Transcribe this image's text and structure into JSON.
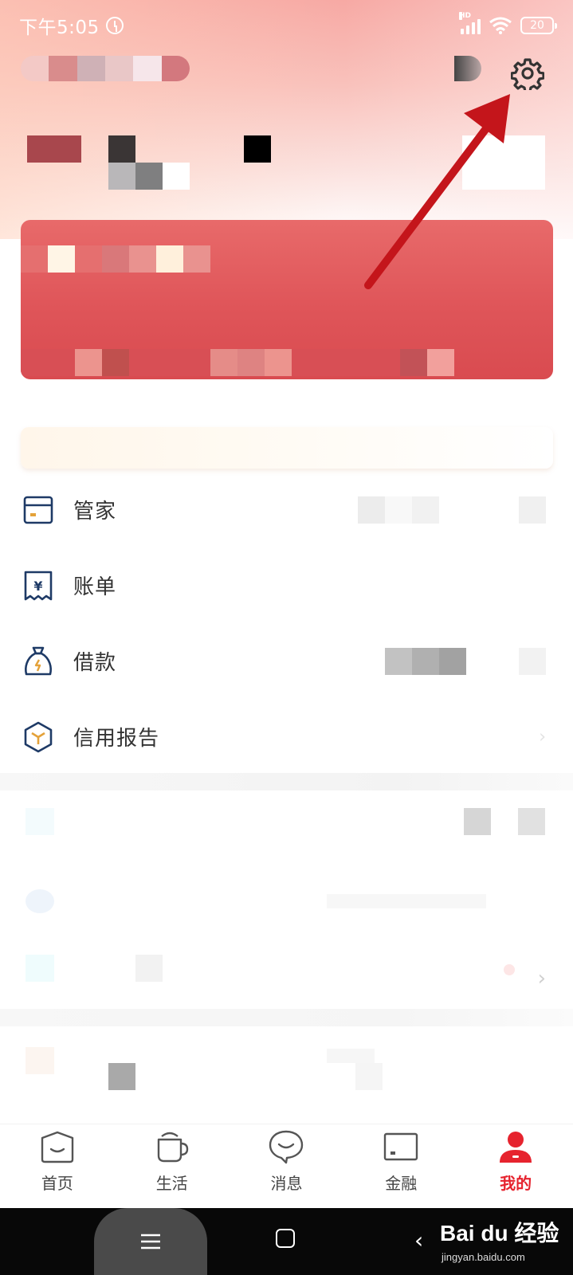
{
  "status_bar": {
    "time": "下午5:05",
    "hd_label": "HD",
    "battery": "20"
  },
  "menu": [
    {
      "label": "管家",
      "icon": "card-icon"
    },
    {
      "label": "账单",
      "icon": "yuan-receipt-icon"
    },
    {
      "label": "借款",
      "icon": "money-bag-icon"
    },
    {
      "label": "信用报告",
      "icon": "cube-icon"
    }
  ],
  "bottom_nav": [
    {
      "label": "首页",
      "icon": "home-icon"
    },
    {
      "label": "生活",
      "icon": "cup-icon"
    },
    {
      "label": "消息",
      "icon": "chat-icon"
    },
    {
      "label": "金融",
      "icon": "finance-card-icon"
    },
    {
      "label": "我的",
      "icon": "user-icon"
    }
  ],
  "active_tab": "我的",
  "colors": {
    "accent": "#e6232e",
    "icon_navy": "#1e3a66",
    "annotation_arrow": "#c4151b"
  },
  "watermark": {
    "brand": "Bai du 经验",
    "url": "jingyan.baidu.com"
  }
}
